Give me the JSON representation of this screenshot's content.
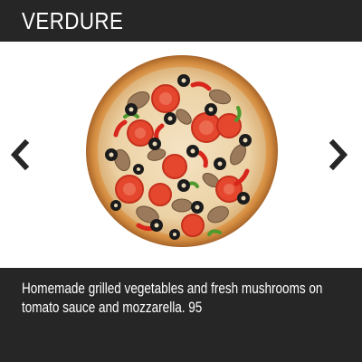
{
  "header": {
    "title": "VERDURE"
  },
  "carousel": {
    "prev_icon": "chevron-left-icon",
    "next_icon": "chevron-right-icon",
    "image": "pizza-image"
  },
  "footer": {
    "description": "Homemade grilled vegetables and fresh mushrooms on tomato sauce and mozzarella. 95"
  },
  "colors": {
    "bar_background": "#262626",
    "bar_text": "#ffffff",
    "arrow": "#262626",
    "page_background": "#ffffff"
  }
}
